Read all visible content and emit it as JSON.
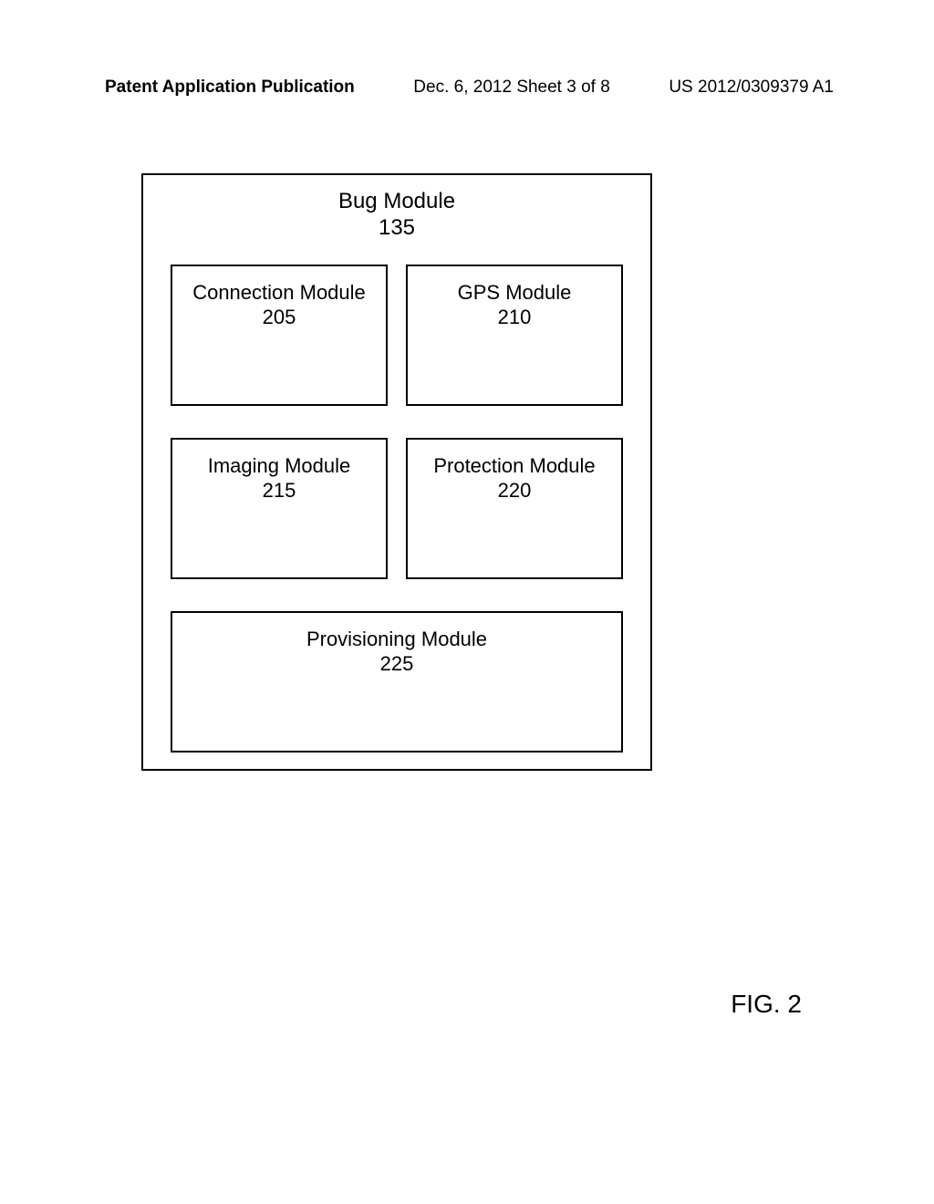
{
  "header": {
    "left": "Patent Application Publication",
    "center": "Dec. 6, 2012  Sheet 3 of 8",
    "right": "US 2012/0309379 A1"
  },
  "diagram": {
    "container": {
      "title": "Bug Module",
      "number": "135"
    },
    "modules": {
      "connection": {
        "title": "Connection Module",
        "number": "205"
      },
      "gps": {
        "title": "GPS Module",
        "number": "210"
      },
      "imaging": {
        "title": "Imaging Module",
        "number": "215"
      },
      "protection": {
        "title": "Protection Module",
        "number": "220"
      },
      "provisioning": {
        "title": "Provisioning Module",
        "number": "225"
      }
    }
  },
  "figure_label": "FIG. 2"
}
